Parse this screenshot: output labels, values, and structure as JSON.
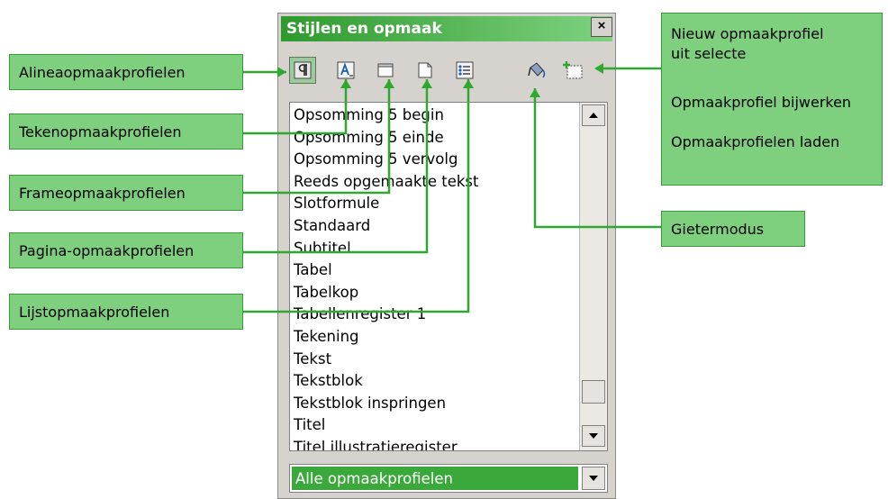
{
  "colors": {
    "callout_fill": "#7ed07e",
    "callout_border": "#3a9a3a",
    "connector": "#2ea82e",
    "selection": "#3aa83a"
  },
  "panel": {
    "title": "Stijlen en opmaak",
    "close_label": "×",
    "toolbar_icons": [
      "paragraph-styles-icon",
      "character-styles-icon",
      "frame-styles-icon",
      "page-styles-icon",
      "list-styles-icon",
      "fill-format-icon",
      "new-style-from-selection-icon"
    ],
    "list_items": [
      "Opsomming 5 begin",
      "Opsomming 5 einde",
      "Opsomming 5 vervolg",
      "Reeds opgemaakte tekst",
      "Slotformule",
      "Standaard",
      "Subtitel",
      "Tabel",
      "Tabelkop",
      "Tabellenregister 1",
      "Tekening",
      "Tekst",
      "Tekstblok",
      "Tekstblok inspringen",
      "Titel",
      "Titel illustratieregister"
    ],
    "filter_value": "Alle opmaakprofielen"
  },
  "callouts": {
    "alinea": "Alineaopmaakprofielen",
    "teken": "Tekenopmaakprofielen",
    "frame": "Frameopmaakprofielen",
    "pagina": "Pagina-opmaakprofielen",
    "lijst": "Lijstopmaakprofielen",
    "gieter": "Gietermodus",
    "right_line1": "Nieuw opmaakprofiel",
    "right_line2": "uit selecte",
    "right_line3": "Opmaakprofiel bijwerken",
    "right_line4": "Opmaakprofielen laden"
  }
}
